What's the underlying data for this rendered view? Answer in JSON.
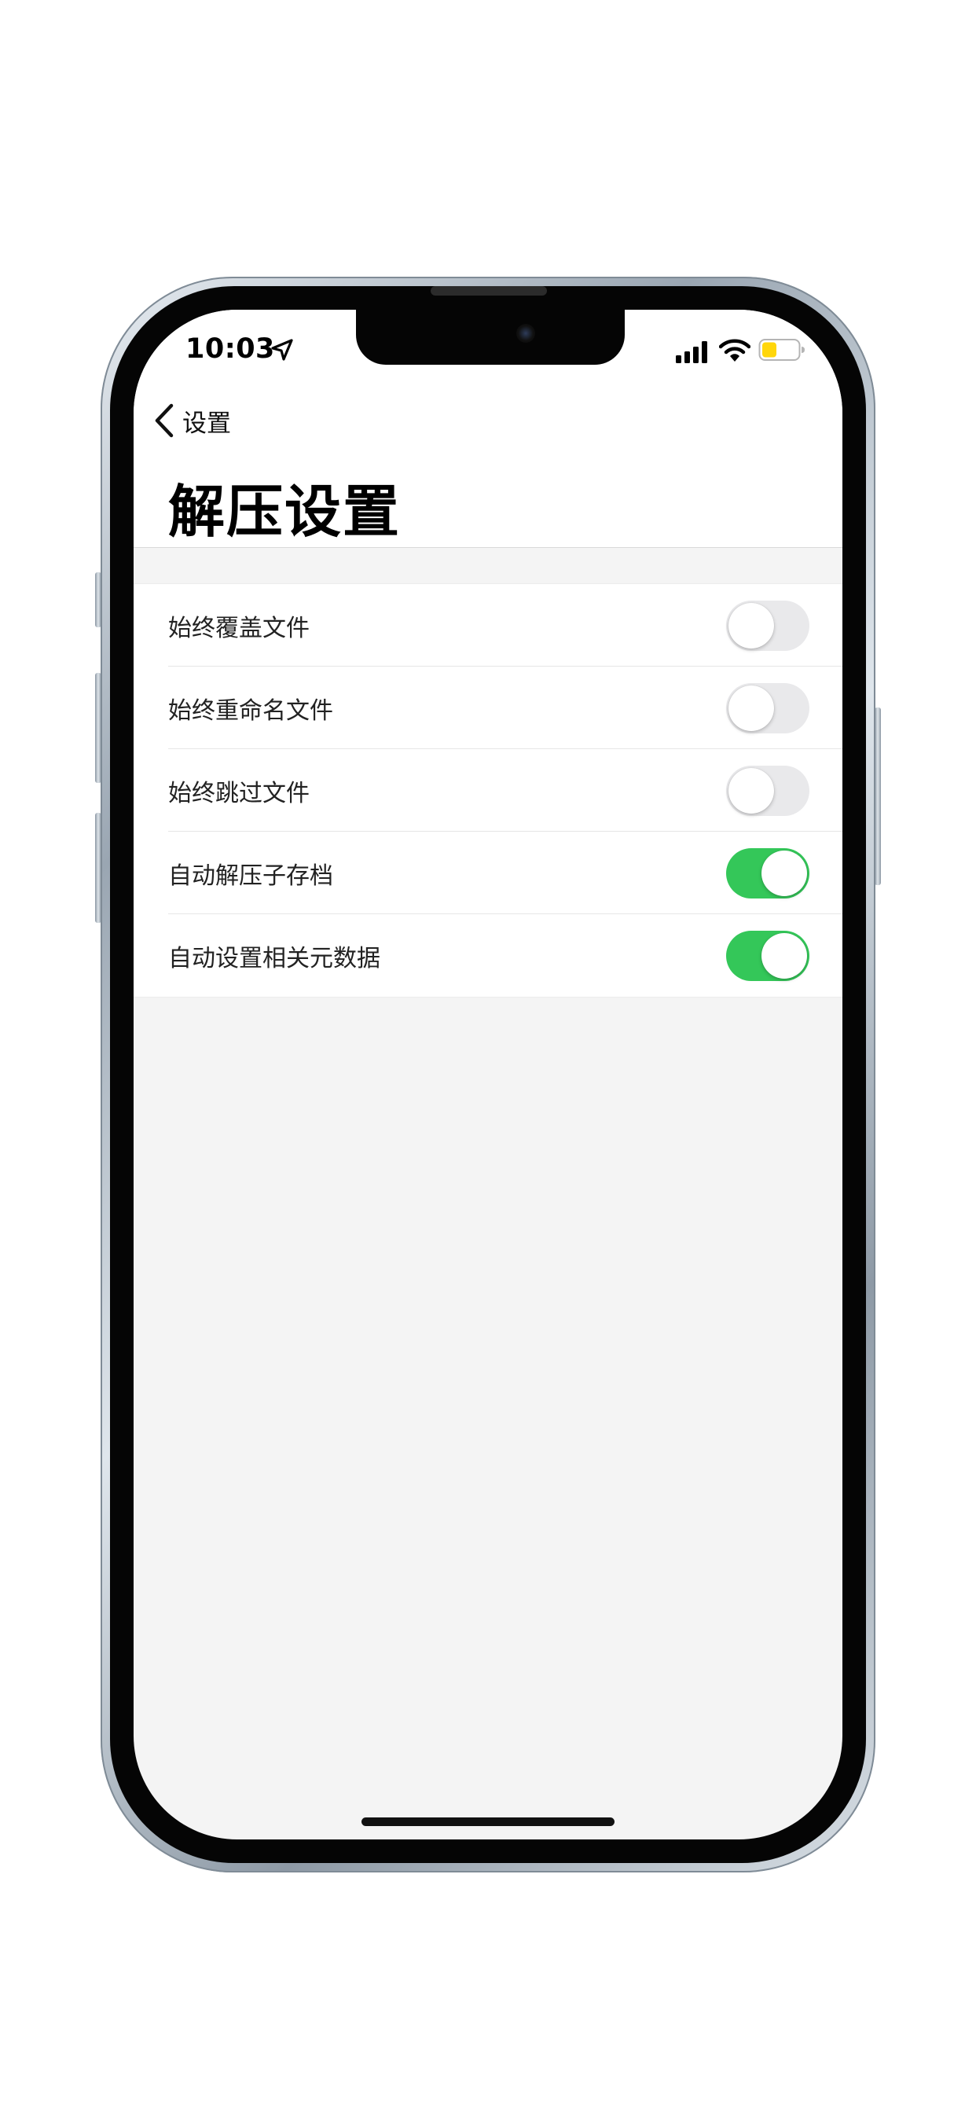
{
  "status_bar": {
    "time": "10:03",
    "location_icon": "location-arrow-icon",
    "signal_icon": "cellular-signal-icon",
    "wifi_icon": "wifi-icon",
    "battery_icon": "battery-low-icon",
    "battery_color": "#ffd60a"
  },
  "nav": {
    "back_label": "设置",
    "back_icon": "chevron-left-icon"
  },
  "page": {
    "title": "解压设置"
  },
  "settings": [
    {
      "label": "始终覆盖文件",
      "enabled": false
    },
    {
      "label": "始终重命名文件",
      "enabled": false
    },
    {
      "label": "始终跳过文件",
      "enabled": false
    },
    {
      "label": "自动解压子存档",
      "enabled": true
    },
    {
      "label": "自动设置相关元数据",
      "enabled": true
    }
  ],
  "colors": {
    "toggle_on": "#34c759",
    "toggle_off": "#e9e9eb",
    "background": "#f4f4f4"
  }
}
